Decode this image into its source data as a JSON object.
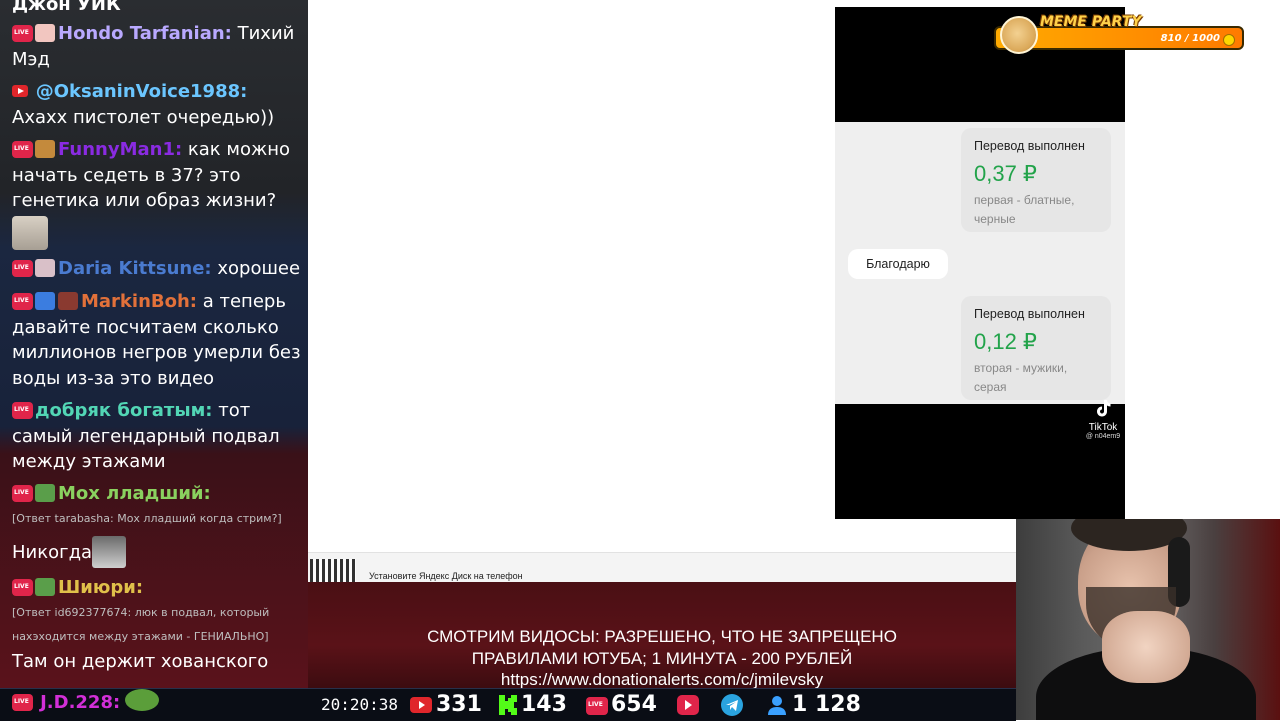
{
  "chat": {
    "messages": [
      {
        "name": "",
        "text": "Джон УИК"
      },
      {
        "name": "Hondo Tarfanian:",
        "name_color": "#b9a9ff",
        "text": "Тихий Мэд"
      },
      {
        "name": "@OksaninVoice1988:",
        "name_color": "#6bc6ff",
        "text": "Ахахх пистолет очередью))"
      },
      {
        "name": "FunnyMan1:",
        "name_color": "#8a2be2",
        "text": "как можно начать седеть в 37? это генетика или образ жизни?"
      },
      {
        "name": "Daria Kittsune:",
        "name_color": "#4a7bd0",
        "text": "хорошее"
      },
      {
        "name": "MarkinBoh:",
        "name_color": "#e2713a",
        "text": "а теперь давайте посчитаем сколько миллионов негров умерли без воды из-за это видео"
      },
      {
        "name": "добряк богатым:",
        "name_color": "#52d6b5",
        "text": "тот самый легендарный подвал между этажами"
      },
      {
        "name": "Мох лладший:",
        "name_color": "#8ad15f",
        "text": ""
      },
      {
        "reply": "[Ответ tarabasha: Мох лладший когда стрим?]"
      },
      {
        "name": "",
        "text": "Никогда"
      },
      {
        "name": "Шиюри:",
        "name_color": "#e0c04a",
        "text": ""
      },
      {
        "reply": "[Ответ id692377674: люк в подвал, который нахэходится между этажами - ГЕНИАЛЬНО]"
      },
      {
        "name": "",
        "text": "Там он держит хованского"
      }
    ],
    "last_user": "J.D.228:"
  },
  "player": {
    "bubble1": {
      "title": "Перевод выполнен",
      "amount": "0,37 ₽",
      "note": "первая - блатные, черные"
    },
    "thanks": "Благодарю",
    "bubble2": {
      "title": "Перевод выполнен",
      "amount": "0,12 ₽",
      "note": "вторая - мужики, серая"
    },
    "tiktok_brand": "TikTok",
    "tiktok_user": "@ n04em9"
  },
  "meme_party": {
    "title": "MEME PARTY",
    "count": "810 / 1000"
  },
  "yandex": {
    "text": "Установите Яндекс Диск на телефон"
  },
  "banner": {
    "line1": "СМОТРИМ ВИДОСЫ: РАЗРЕШЕНО, ЧТО НЕ ЗАПРЕЩЕНО",
    "line2": "ПРАВИЛАМИ ЮТУБА; 1 МИНУТА - 200 РУБЛЕЙ",
    "line3": "https://www.donationalerts.com/c/jmilevsky"
  },
  "stats": {
    "time": "20:20:38",
    "youtube": "331",
    "kick": "143",
    "vk": "654",
    "subscribers": "1 128"
  }
}
